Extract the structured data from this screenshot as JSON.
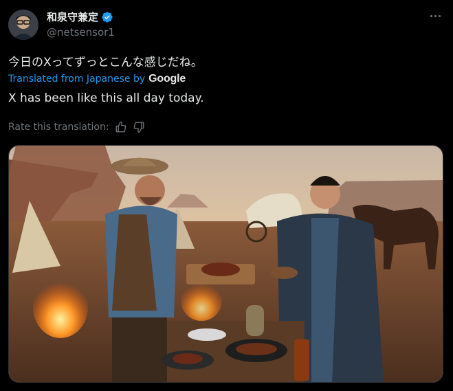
{
  "author": {
    "display_name": "和泉守兼定",
    "handle": "@netsensor1",
    "verified_icon": "verified-badge-icon",
    "avatar_icon": "avatar"
  },
  "menu": {
    "more_icon": "more-icon"
  },
  "post": {
    "original_text": "今日のXってずっとこんな感じだね。",
    "translated_from": "Translated from Japanese by",
    "translator": "Google",
    "translation": "X has been like this all day today.",
    "rate_label": "Rate this translation:"
  },
  "colors": {
    "accent": "#1d9bf0",
    "muted": "#71767b",
    "text": "#e7e9ea",
    "background": "#000000"
  }
}
